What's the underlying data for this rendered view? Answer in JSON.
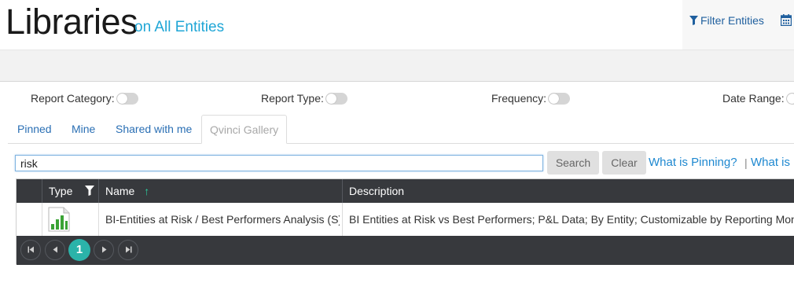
{
  "header": {
    "title": "Libraries",
    "subtitle": "on All Entities",
    "filter_label": "Filter Entities",
    "filter_icon": "funnel-icon",
    "calendar_icon": "calendar-icon"
  },
  "filters": [
    {
      "label": "Report Category:"
    },
    {
      "label": "Report Type:"
    },
    {
      "label": "Frequency:"
    },
    {
      "label": "Date Range:"
    }
  ],
  "tabs": [
    {
      "label": "Pinned",
      "active": false
    },
    {
      "label": "Mine",
      "active": false
    },
    {
      "label": "Shared with me",
      "active": false
    },
    {
      "label": "Qvinci Gallery",
      "active": true
    }
  ],
  "search": {
    "value": "risk",
    "search_label": "Search",
    "clear_label": "Clear",
    "help_link_1": "What is Pinning?",
    "separator": "|",
    "help_link_2": "What is"
  },
  "table": {
    "columns": [
      "Type",
      "Name",
      "Description"
    ],
    "sort_indicator": "↑",
    "rows": [
      {
        "type_icon": "bar-chart-icon",
        "name": "BI-Entities at Risk / Best Performers Analysis (S)",
        "description": "BI Entities at Risk vs Best Performers; P&L Data; By Entity; Customizable by Reporting Month ("
      }
    ]
  },
  "pager": {
    "current_page": "1",
    "first_icon": "first-page-icon",
    "prev_icon": "prev-page-icon",
    "next_icon": "next-page-icon",
    "last_icon": "last-page-icon"
  },
  "colors": {
    "accent": "#1fa6d6",
    "grid_header": "#37393d",
    "page_active": "#2bb3a9"
  }
}
